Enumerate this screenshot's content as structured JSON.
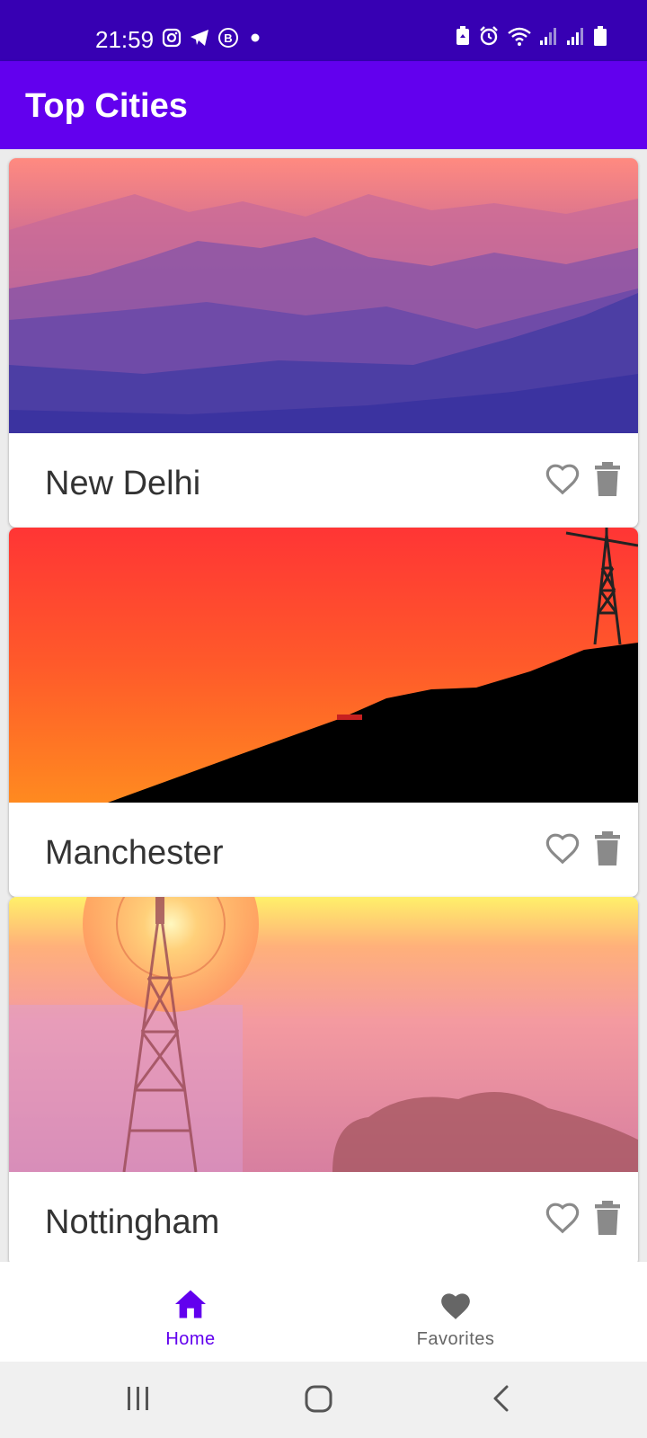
{
  "status_bar": {
    "time": "21:59",
    "notification_icons": [
      "instagram-icon",
      "telegram-icon",
      "b-icon",
      "dot-icon"
    ],
    "system_icons": [
      "battery-saver-icon",
      "alarm-icon",
      "wifi-icon",
      "signal-icon",
      "signal-icon",
      "battery-icon"
    ]
  },
  "app_bar": {
    "title": "Top Cities",
    "color": "#6200ee"
  },
  "cities": [
    {
      "name": "New Delhi",
      "image": "mountains-dusk",
      "favorite": false
    },
    {
      "name": "Manchester",
      "image": "sunset-hill-windmill",
      "favorite": false
    },
    {
      "name": "Nottingham",
      "image": "windmill-pink-fog",
      "favorite": false
    }
  ],
  "bottom_nav": {
    "items": [
      {
        "label": "Home",
        "icon": "home-icon",
        "active": true
      },
      {
        "label": "Favorites",
        "icon": "heart-icon",
        "active": false
      }
    ],
    "active_color": "#6200ee",
    "inactive_color": "#666666"
  },
  "system_nav": [
    "recents-icon",
    "home-circle-icon",
    "back-icon"
  ]
}
